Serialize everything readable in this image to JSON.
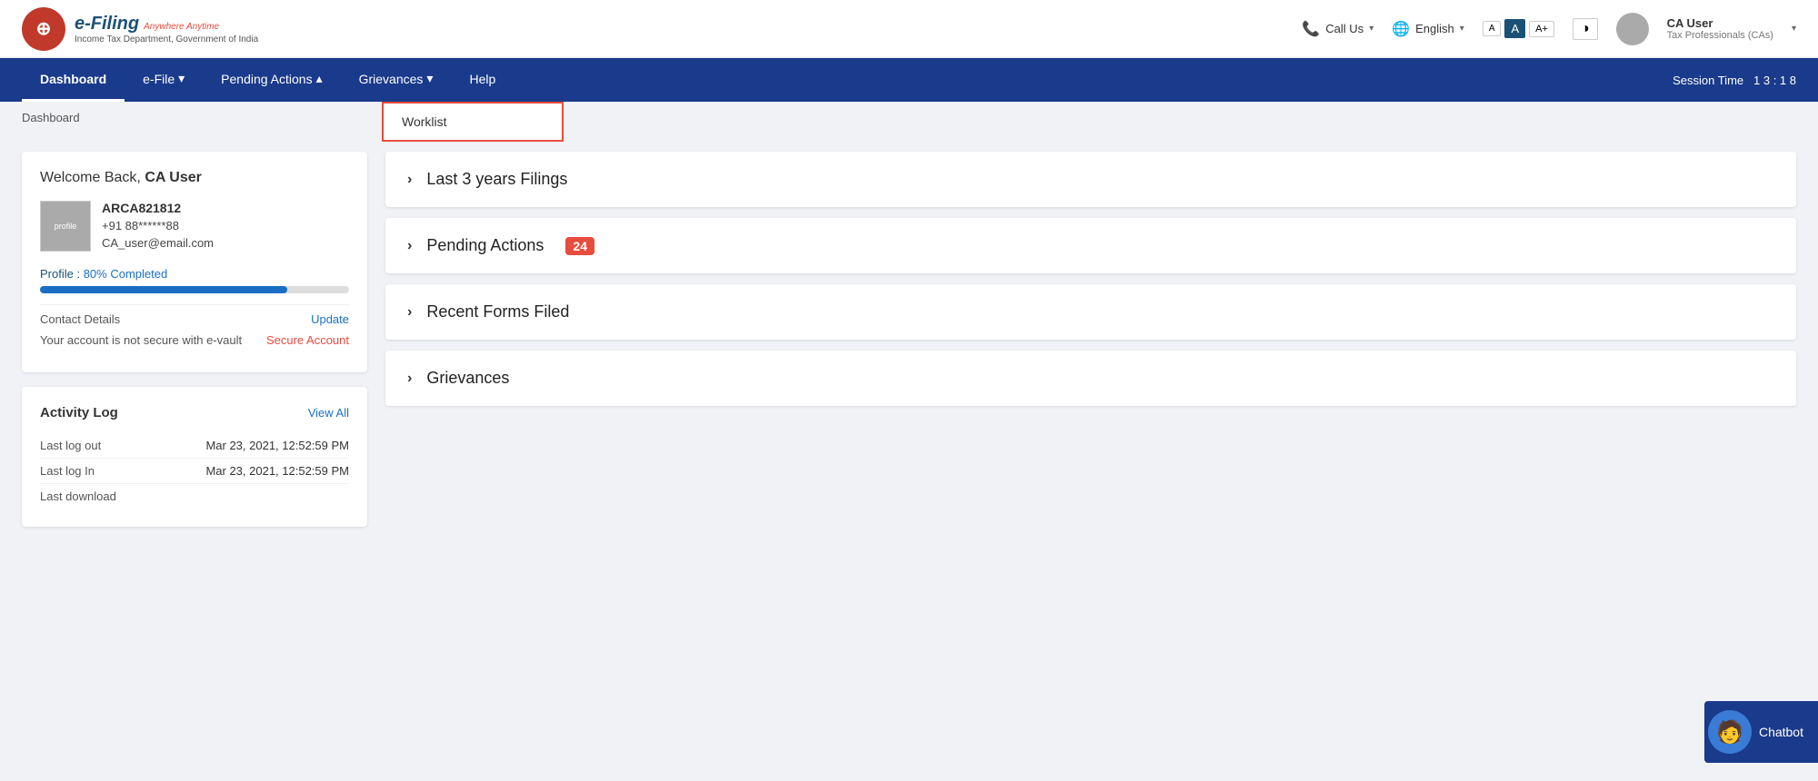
{
  "topbar": {
    "logo_efiling": "e-Filing",
    "logo_tagline": "Anywhere Anytime",
    "logo_subtitle": "Income Tax Department, Government of India",
    "call_us": "Call Us",
    "language": "English",
    "font_small": "A",
    "font_medium": "A",
    "font_large": "A+",
    "contrast_icon": "◑",
    "user_name": "CA User",
    "user_role": "Tax Professionals (CAs)"
  },
  "navbar": {
    "items": [
      {
        "label": "Dashboard",
        "active": true
      },
      {
        "label": "e-File",
        "has_dropdown": true
      },
      {
        "label": "Pending Actions",
        "has_dropdown": true
      },
      {
        "label": "Grievances",
        "has_dropdown": true
      },
      {
        "label": "Help",
        "has_dropdown": false
      }
    ],
    "session_label": "Session Time",
    "session_time": "1  3  :  1  8"
  },
  "dropdown": {
    "label": "Worklist"
  },
  "breadcrumb": {
    "text": "Dashboard"
  },
  "profile_card": {
    "welcome": "Welcome Back,",
    "user_name": "CA User",
    "profile_id": "ARCA821812",
    "phone": "+91  88******88",
    "email": "CA_user@email.com",
    "profile_label": "Profile :",
    "profile_percent": "80% Completed",
    "progress": 80,
    "contact_label": "Contact Details",
    "contact_link": "Update",
    "security_text": "Your account is not secure with e-vault",
    "security_link": "Secure Account"
  },
  "activity_log": {
    "title": "Activity Log",
    "view_all": "View All",
    "rows": [
      {
        "label": "Last log out",
        "value": "Mar 23, 2021, 12:52:59 PM"
      },
      {
        "label": "Last log In",
        "value": "Mar 23, 2021, 12:52:59 PM"
      },
      {
        "label": "Last download",
        "value": ""
      }
    ]
  },
  "accordion": {
    "items": [
      {
        "label": "Last 3 years Filings",
        "badge": null
      },
      {
        "label": "Pending Actions",
        "badge": "24"
      },
      {
        "label": "Recent Forms Filed",
        "badge": null
      },
      {
        "label": "Grievances",
        "badge": null
      }
    ]
  },
  "chatbot": {
    "label": "Chatbot"
  }
}
